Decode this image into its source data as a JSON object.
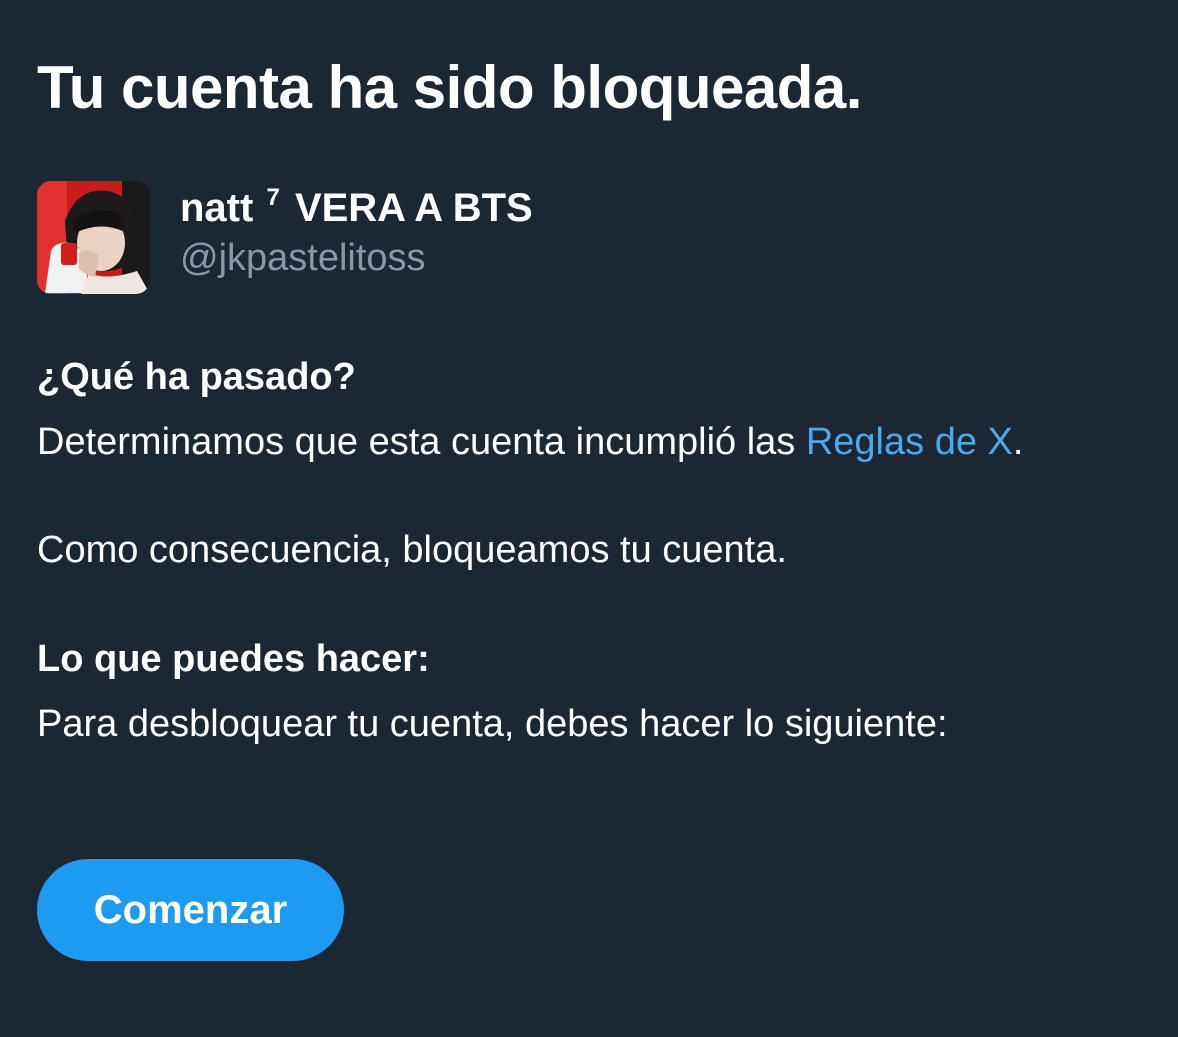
{
  "title": "Tu cuenta ha sido bloqueada.",
  "account": {
    "name": "natt",
    "name_sup": "7",
    "name_suffix": "VERA A BTS",
    "handle": "@jkpastelitoss",
    "avatar_icon": "profile-photo"
  },
  "what_happened": {
    "heading": "¿Qué ha pasado?",
    "text_before_link": "Determinamos que esta cuenta incumplió las ",
    "link": "Reglas de X",
    "text_after_link": ".",
    "consequence": "Como consecuencia, bloqueamos tu cuenta."
  },
  "what_you_can_do": {
    "heading": "Lo que puedes hacer:",
    "text": "Para desbloquear tu cuenta, debes hacer lo siguiente:"
  },
  "button": {
    "label": "Comenzar"
  },
  "colors": {
    "background": "#1c2734",
    "link": "#4aa8eb",
    "secondary_text": "#8899a6",
    "button": "#1d9bf0"
  }
}
